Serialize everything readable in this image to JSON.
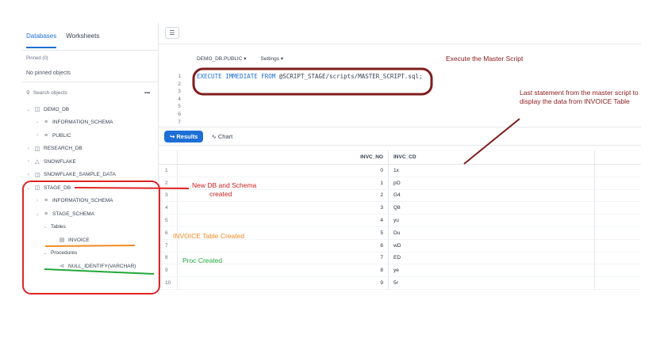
{
  "sidebar": {
    "tabs": [
      "Databases",
      "Worksheets"
    ],
    "pinned_header": "Pinned (0)",
    "pinned_empty": "No pinned objects",
    "search_placeholder": "Search objects",
    "search_more": "•••",
    "tree": [
      {
        "label": "DEMO_DB"
      },
      {
        "label": "INFORMATION_SCHEMA"
      },
      {
        "label": "PUBLIC"
      },
      {
        "label": "RESEARCH_DB"
      },
      {
        "label": "SNOWFLAKE"
      },
      {
        "label": "SNOWFLAKE_SAMPLE_DATA"
      },
      {
        "label": "STAGE_DB"
      },
      {
        "label": "INFORMATION_SCHEMA"
      },
      {
        "label": "STAGE_SCHEMA"
      },
      {
        "label": "Tables"
      },
      {
        "label": "INVOICE"
      },
      {
        "label": "Procedures"
      },
      {
        "label": "NULL_IDENTIFY(VARCHAR)"
      }
    ]
  },
  "editor": {
    "context_db": "DEMO_DB.PUBLIC",
    "settings": "Settings",
    "line_numbers": [
      "1",
      "2",
      "3",
      "4",
      "5",
      "6",
      "7"
    ],
    "code_kw1": "EXECUTE IMMEDIATE FROM",
    "code_rest": " @SCRIPT_STAGE/scripts/MASTER_SCRIPT.sql;"
  },
  "results": {
    "results_label": "Results",
    "chart_label": "Chart",
    "columns": [
      "INVC_NO",
      "INVC_CD"
    ],
    "rows": [
      [
        "1",
        "0",
        "1x"
      ],
      [
        "2",
        "1",
        "pO"
      ],
      [
        "3",
        "2",
        "G4"
      ],
      [
        "4",
        "3",
        "Q8"
      ],
      [
        "5",
        "4",
        "yu"
      ],
      [
        "6",
        "5",
        "Du"
      ],
      [
        "7",
        "6",
        "wD"
      ],
      [
        "8",
        "7",
        "ED"
      ],
      [
        "9",
        "8",
        "ye"
      ],
      [
        "10",
        "9",
        "5r"
      ]
    ]
  },
  "annotations": {
    "master": "Execute the Master Script",
    "last_statement": "Last statement from the master script to display the data from INVOICE Table",
    "new_db_1": "New DB and Schema",
    "new_db_2": "created",
    "invoice_created": "INVOICE Table Created",
    "proc_created": "Proc Created"
  },
  "colors": {
    "accent": "#1d6fd6",
    "annotation_red": "#8b1a1a",
    "highlight_red": "#e02424",
    "orange": "#f08a24",
    "green": "#22a83a"
  }
}
